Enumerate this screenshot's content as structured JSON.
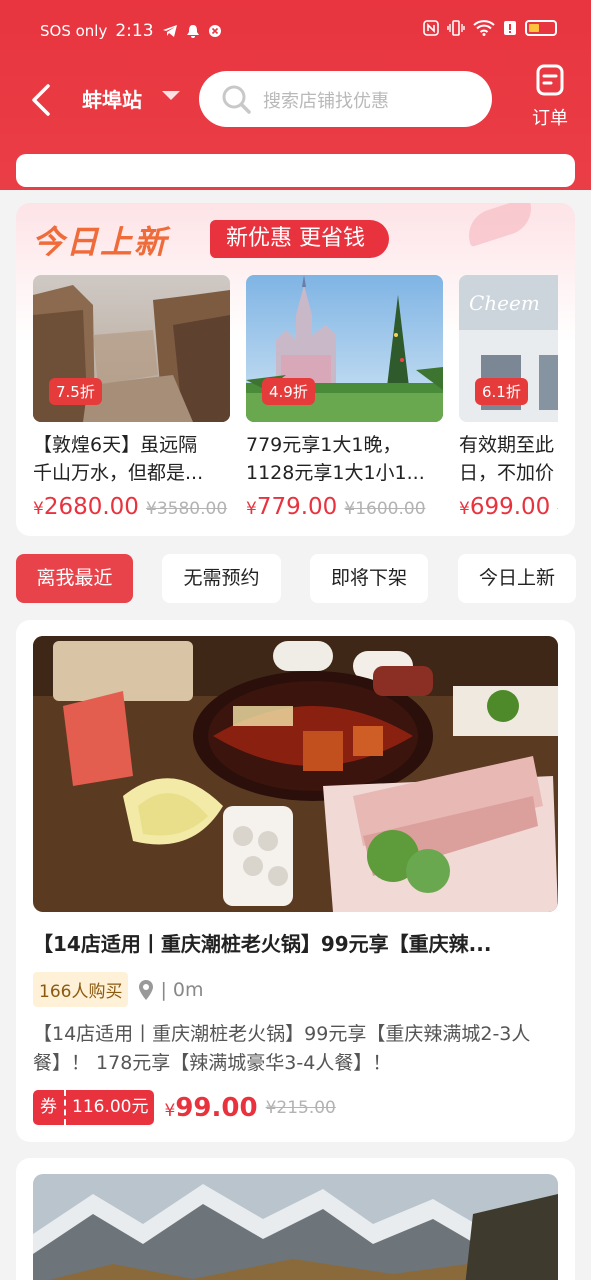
{
  "status_bar": {
    "sos": "SOS only",
    "time": "2:13"
  },
  "nav": {
    "station": "蚌埠站",
    "search_placeholder": "搜索店铺找优惠",
    "order_label": "订单"
  },
  "today_new": {
    "title": "今日上新",
    "slogan": "新优惠 更省钱",
    "items": [
      {
        "discount": "7.5折",
        "desc_line1": "【敦煌6天】虽远隔",
        "desc_line2": "千山万水，但都是...",
        "price": "2680.00",
        "original_price": "¥3580.00"
      },
      {
        "discount": "4.9折",
        "desc_line1": "779元享1大1晚，",
        "desc_line2": "1128元享1大1小1...",
        "price": "779.00",
        "original_price": "¥1600.00"
      },
      {
        "discount": "6.1折",
        "desc_line1": "有效期至此",
        "desc_line2": "日，不加价",
        "price": "699.00",
        "original_price": "¥"
      }
    ]
  },
  "filters": [
    "离我最近",
    "无需预约",
    "即将下架",
    "今日上新"
  ],
  "product": {
    "title": "【14店适用丨重庆潮桩老火锅】99元享【重庆辣...",
    "bought": "166人购买",
    "distance": "| 0m",
    "desc": "【14店适用丨重庆潮桩老火锅】99元享【重庆辣满城2-3人餐】！ 178元享【辣满城豪华3-4人餐】！",
    "coupon_tag": "券",
    "coupon_value": "116.00元",
    "price": "99.00",
    "original_price": "¥215.00"
  },
  "colors": {
    "brand_red": "#e8333f",
    "title_orange": "#ef6c3a",
    "bought_bg": "#fff1d7"
  },
  "currency_symbol": "¥"
}
